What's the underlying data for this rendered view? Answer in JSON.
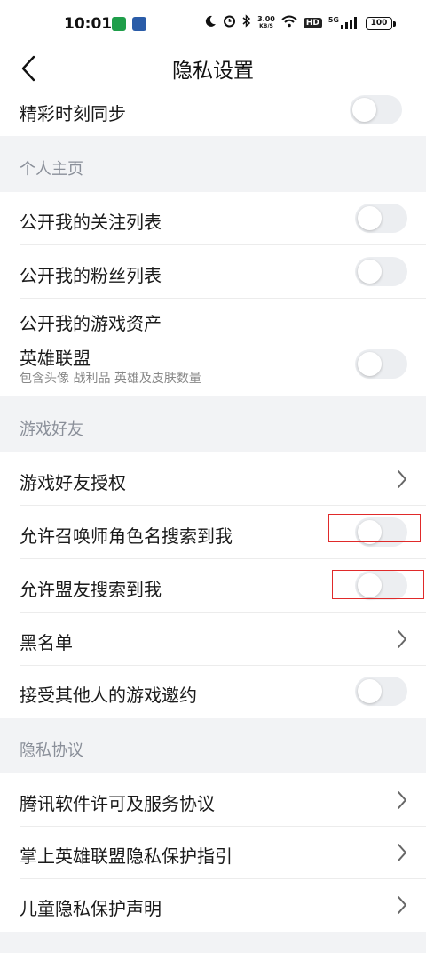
{
  "status_bar": {
    "time": "10:01",
    "net_speed_value": "3.00",
    "net_speed_unit": "KB/S",
    "hd": "HD",
    "network": "5G",
    "battery": "100",
    "icons": [
      "moon-icon",
      "alarm-icon",
      "bluetooth-icon",
      "wifi-icon",
      "signal-icon"
    ]
  },
  "header": {
    "title": "隐私设置",
    "back_icon": "chevron-left-icon"
  },
  "rows": {
    "highlight_sync": {
      "label": "精彩时刻同步",
      "toggle_on": false
    },
    "follow_list": {
      "label": "公开我的关注列表",
      "toggle_on": false
    },
    "fans_list": {
      "label": "公开我的粉丝列表",
      "toggle_on": false
    },
    "game_assets": {
      "label": "公开我的游戏资产"
    },
    "lol": {
      "label": "英雄联盟",
      "sub": "包含头像 战利品 英雄及皮肤数量",
      "toggle_on": false
    },
    "friend_auth": {
      "label": "游戏好友授权"
    },
    "summoner_search": {
      "label": "允许召唤师角色名搜索到我",
      "toggle_on": false
    },
    "ally_search": {
      "label": "允许盟友搜索到我",
      "toggle_on": false
    },
    "blacklist": {
      "label": "黑名单"
    },
    "accept_invites": {
      "label": "接受其他人的游戏邀约",
      "toggle_on": false
    },
    "tencent_license": {
      "label": "腾讯软件许可及服务协议"
    },
    "privacy_guide": {
      "label": "掌上英雄联盟隐私保护指引"
    },
    "child_privacy": {
      "label": "儿童隐私保护声明"
    }
  },
  "sections": {
    "profile": "个人主页",
    "game_friends": "游戏好友",
    "privacy_agreement": "隐私协议"
  },
  "colors": {
    "background": "#f2f3f5",
    "card": "#ffffff",
    "toggle_off": "#eceef1",
    "section_text": "#8a8f99",
    "highlight_box": "#e02a2a"
  }
}
